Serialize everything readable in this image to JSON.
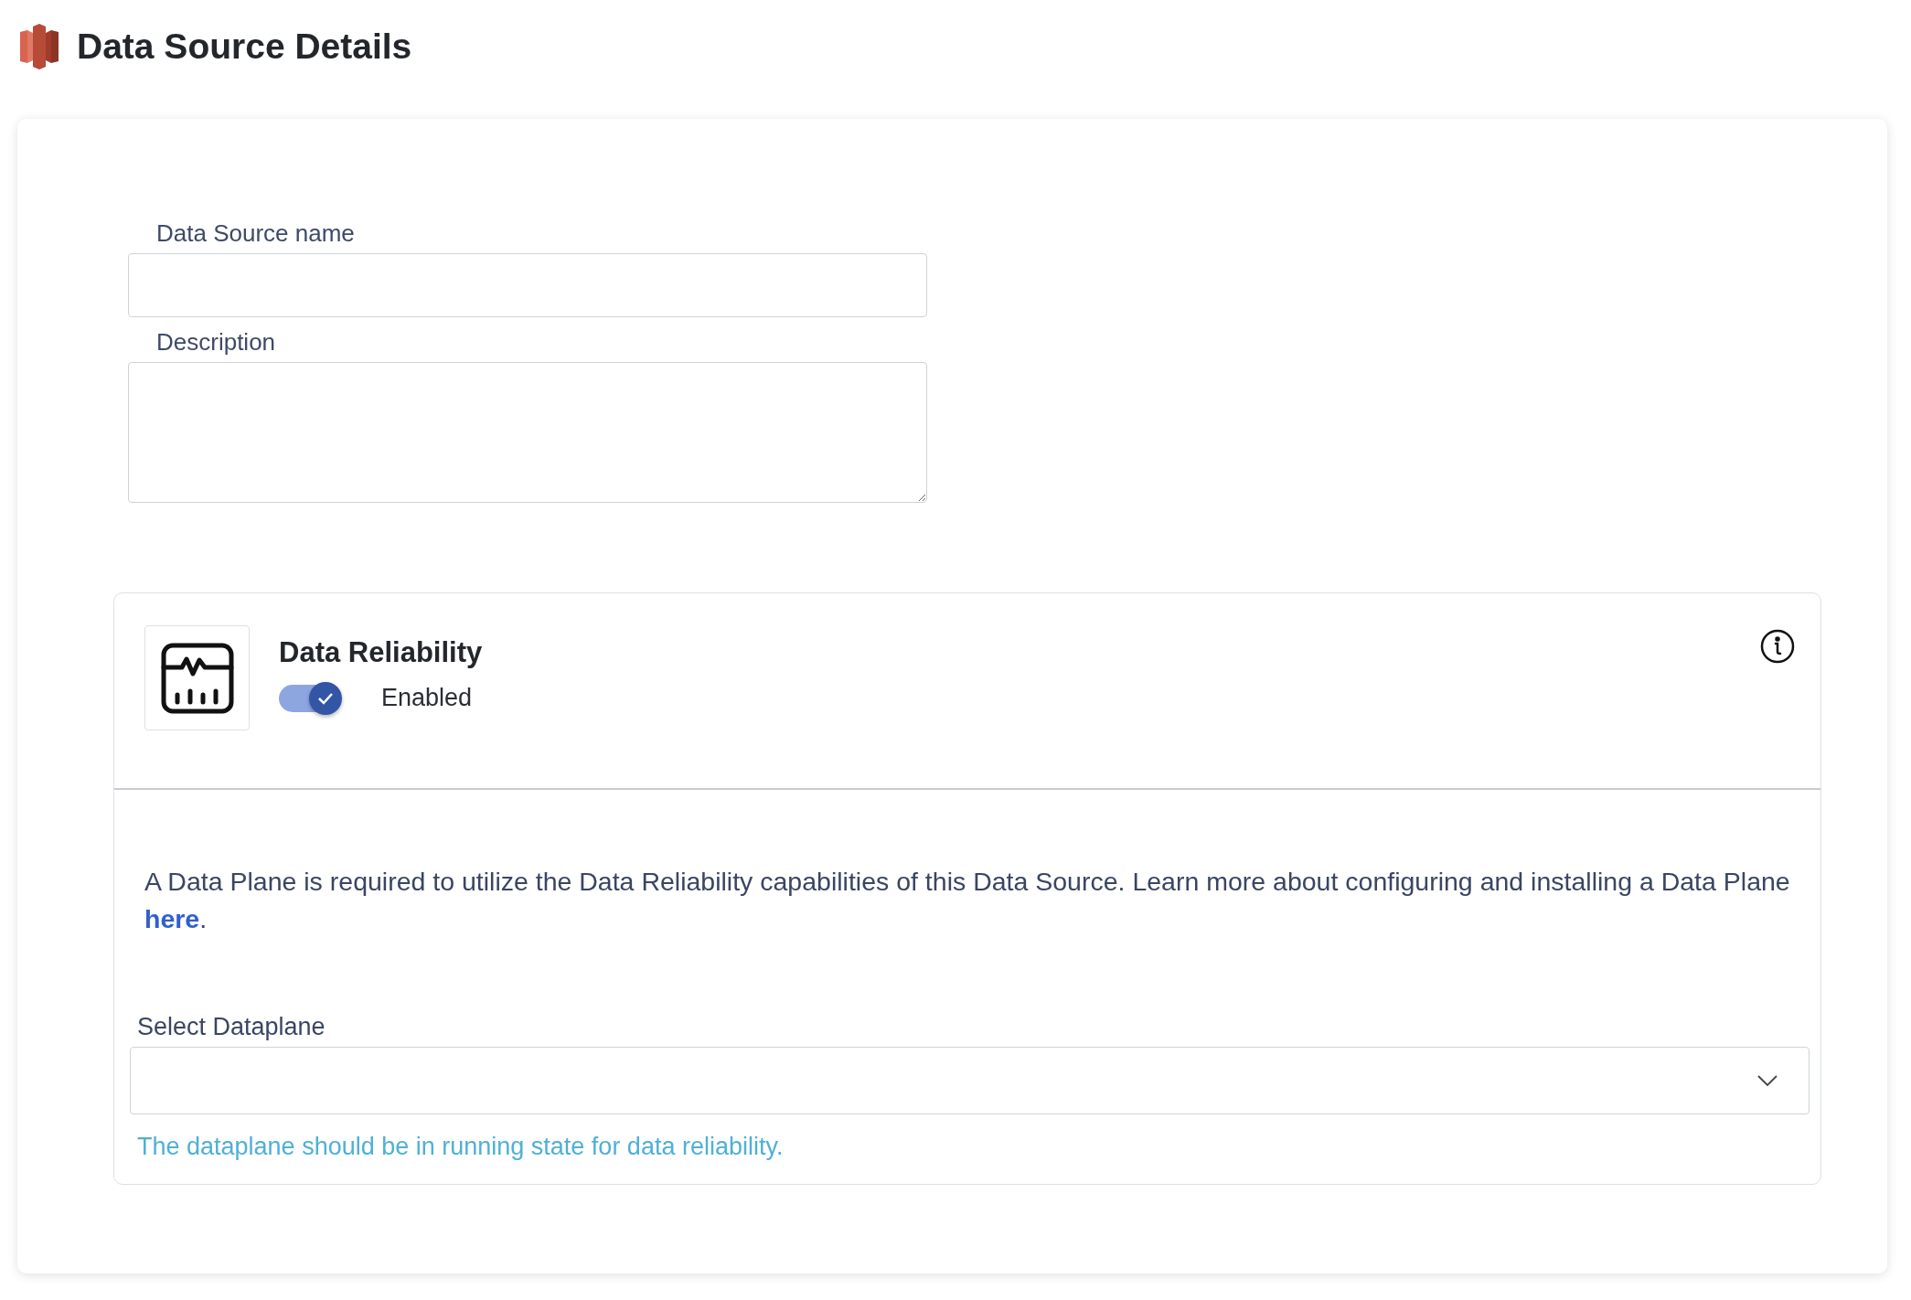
{
  "page": {
    "title": "Data Source Details"
  },
  "form": {
    "fields": [
      {
        "kind": "input",
        "label": "Data Source name"
      },
      {
        "kind": "textarea",
        "label": "Description"
      }
    ]
  },
  "reliability": {
    "title": "Data Reliability",
    "toggle": {
      "on": true,
      "label": "Enabled"
    },
    "notice": {
      "text": "A Data Plane is required to utilize the Data Reliability capabilities of this Data Source. Learn more about configuring and installing a Data Plane ",
      "link": "here",
      "after": "."
    },
    "select": {
      "label": "Select Dataplane",
      "hint": "The dataplane should be in running state for data reliability."
    }
  }
}
